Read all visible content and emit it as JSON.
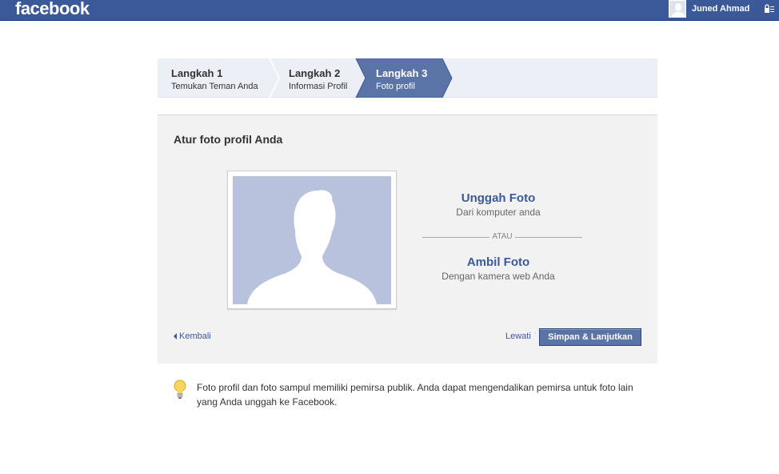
{
  "header": {
    "logo": "facebook",
    "user_name": "Juned Ahmad"
  },
  "steps": [
    {
      "title": "Langkah 1",
      "subtitle": "Temukan Teman Anda",
      "active": false
    },
    {
      "title": "Langkah 2",
      "subtitle": "Informasi Profil",
      "active": false
    },
    {
      "title": "Langkah 3",
      "subtitle": "Foto profil",
      "active": true
    }
  ],
  "panel": {
    "title": "Atur foto profil Anda",
    "upload": {
      "title": "Unggah Foto",
      "subtitle": "Dari komputer anda"
    },
    "or_label": "ATAU",
    "camera": {
      "title": "Ambil Foto",
      "subtitle": "Dengan kamera web Anda"
    },
    "back_label": "Kembali",
    "skip_label": "Lewati",
    "save_label": "Simpan & Lanjutkan"
  },
  "info": {
    "text": "Foto profil dan foto sampul memiliki pemirsa publik. Anda dapat mengendalikan pemirsa untuk foto lain yang Anda unggah ke Facebook."
  },
  "colors": {
    "brand": "#3b5998",
    "active_step": "#5b74a8",
    "placeholder_bg": "#b9c2dc"
  }
}
